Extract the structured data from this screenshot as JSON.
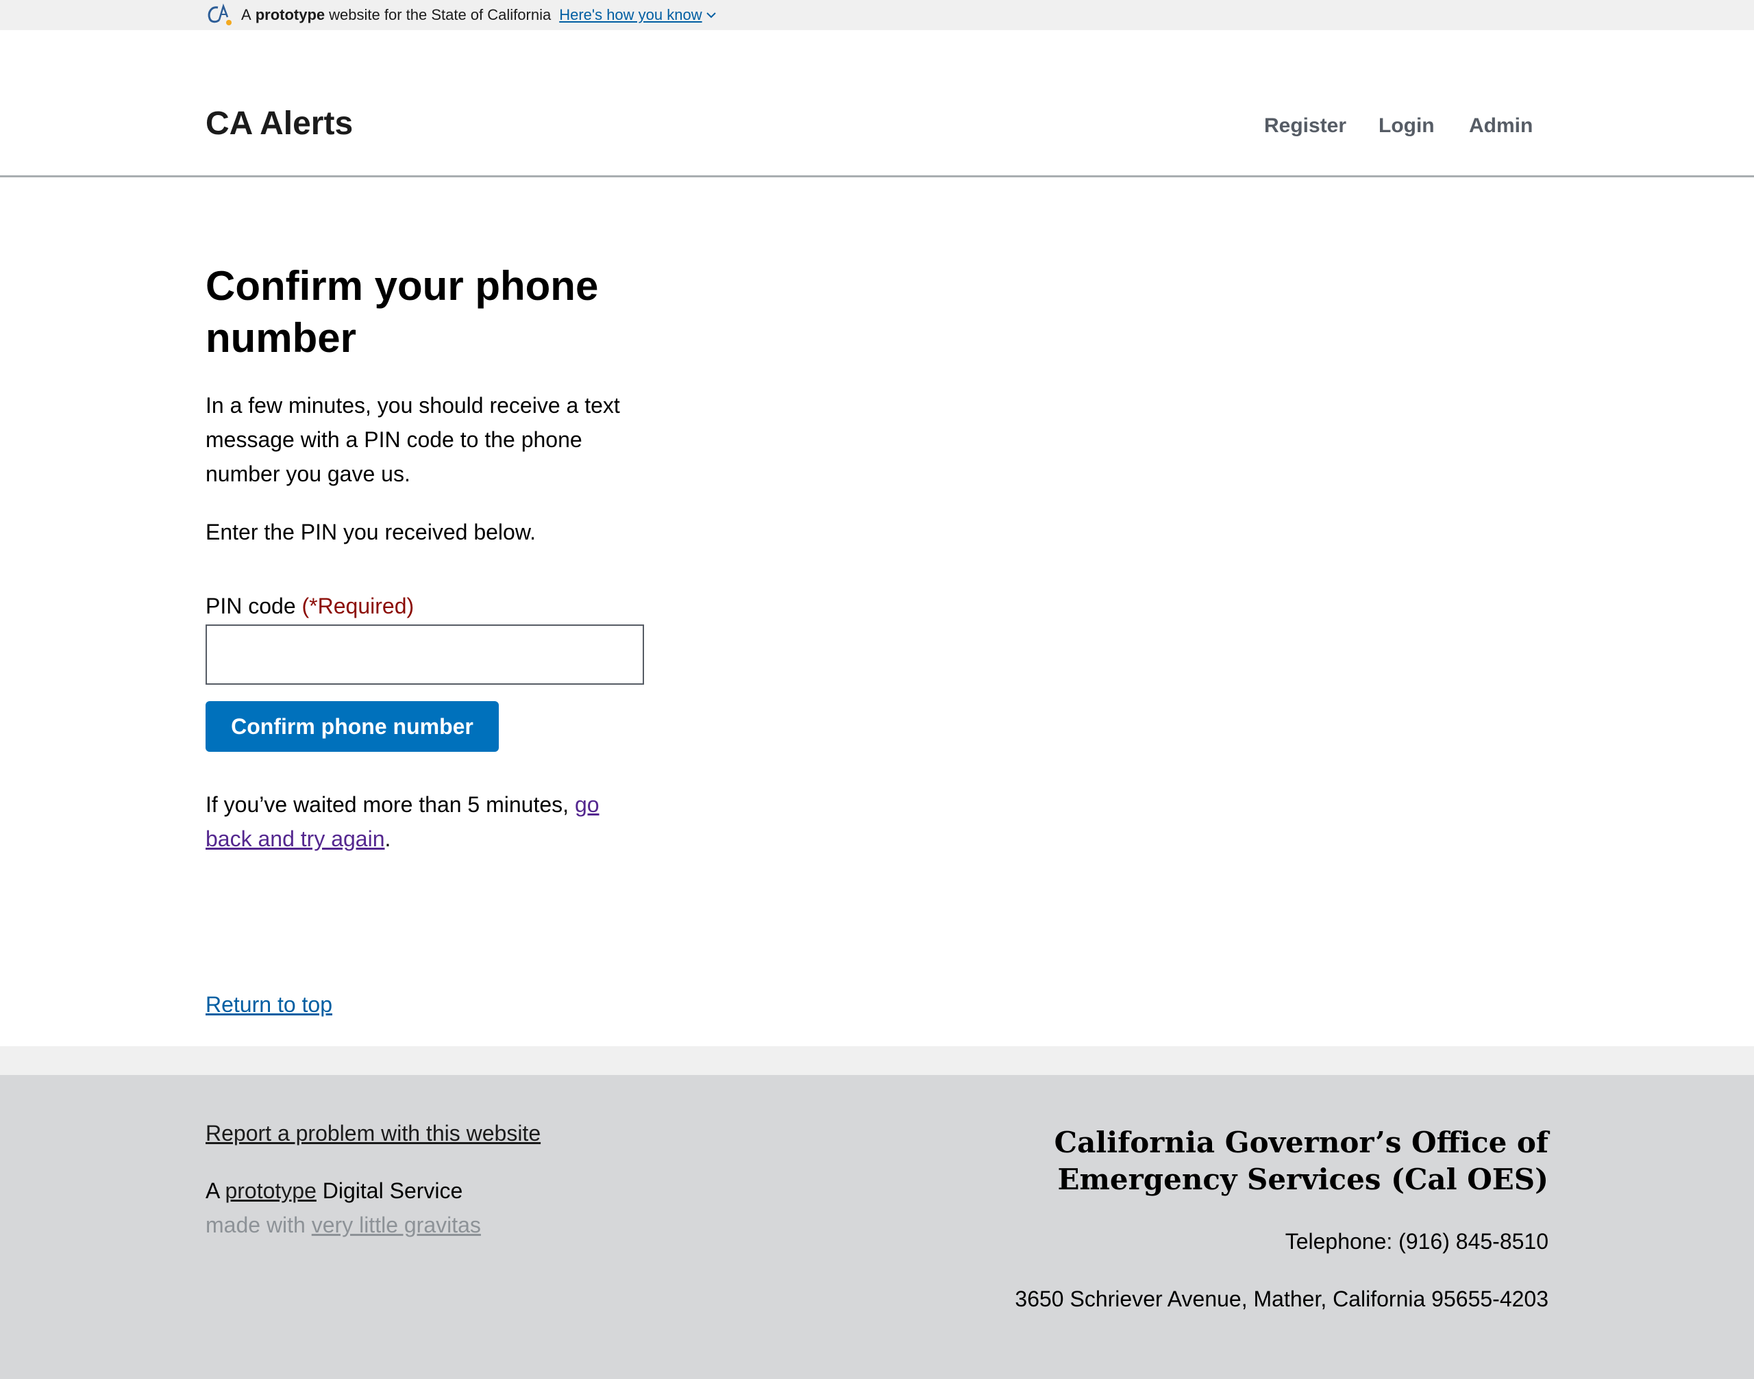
{
  "banner": {
    "prefix": "A",
    "strong": "prototype",
    "rest": "website for the State of California",
    "link_label": "Here's how you know"
  },
  "header": {
    "site_title": "CA Alerts",
    "nav": [
      "Register",
      "Login",
      "Admin"
    ]
  },
  "main": {
    "title": "Confirm your phone number",
    "intro": "In a few minutes, you should receive a text message with a PIN code to the phone number you gave us.",
    "instruction": "Enter the PIN you received below.",
    "pin_label": "PIN code",
    "required_marker": "(*Required)",
    "pin_value": "",
    "submit_label": "Confirm phone number",
    "retry_prefix": "If you’ve waited more than 5 minutes, ",
    "retry_link": "go back and try again",
    "retry_suffix": "."
  },
  "return_to_top": "Return to top",
  "footer": {
    "report_link": "Report a problem with this website",
    "proto_prefix": "A ",
    "proto_link": "prototype",
    "proto_suffix": " Digital Service",
    "made_prefix": "made with ",
    "made_link": "very little gravitas",
    "agency": "California Governor’s Office of Emergency Services (Cal OES)",
    "telephone": "Telephone: (916) 845-8510",
    "address": "3650 Schriever Avenue, Mather, California 95655-4203"
  },
  "colors": {
    "primary_button": "#0071bc",
    "link": "#005ea2",
    "visited_link": "#54278f",
    "required": "#8b0a03",
    "footer_bg": "#d6d7d9"
  }
}
